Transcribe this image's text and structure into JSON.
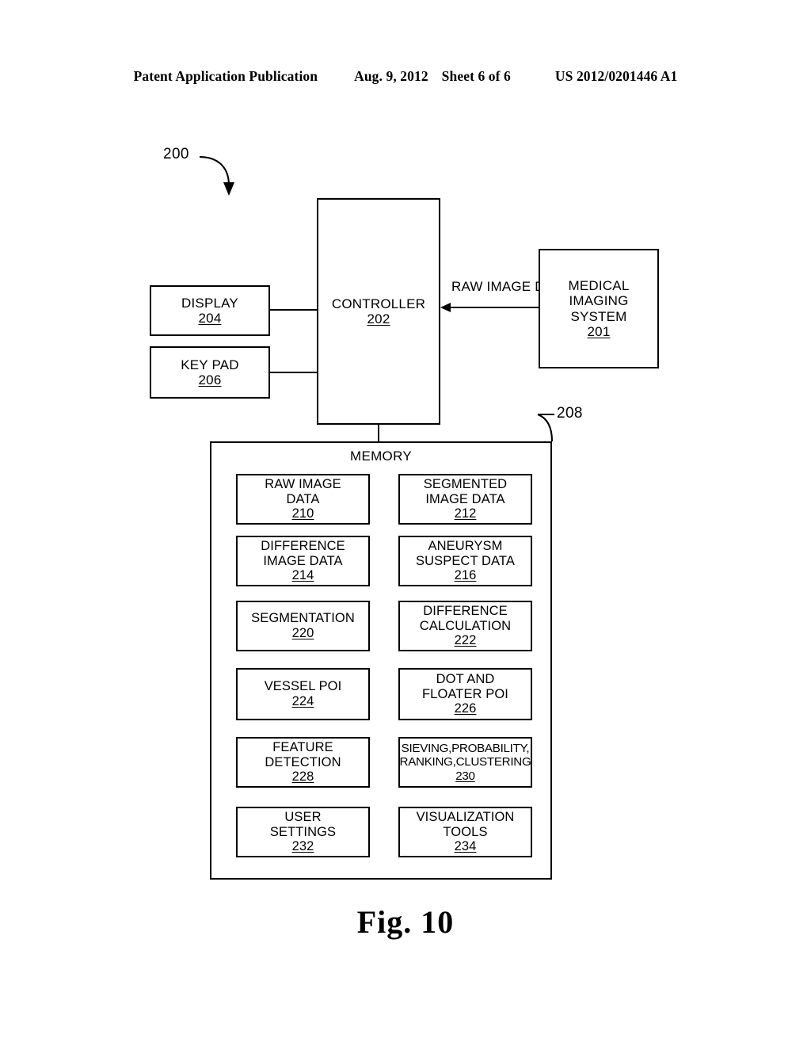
{
  "header": {
    "publication": "Patent Application Publication",
    "date": "Aug. 9, 2012",
    "sheet": "Sheet 6 of 6",
    "number": "US 2012/0201446 A1"
  },
  "figure": {
    "caption": "Fig. 10",
    "system_ref": "200",
    "memory_ref": "208"
  },
  "flow_labels": {
    "raw_image_data_line1": "RAW IMAGE",
    "raw_image_data_line2": "DATA"
  },
  "boxes": {
    "display": {
      "line1": "DISPLAY",
      "ref": "204"
    },
    "keypad": {
      "line1": "KEY PAD",
      "ref": "206"
    },
    "controller": {
      "line1": "CONTROLLER",
      "ref": "202"
    },
    "medical": {
      "line1": "MEDICAL",
      "line2": "IMAGING",
      "line3": "SYSTEM",
      "ref": "201"
    }
  },
  "memory": {
    "title": "MEMORY",
    "cells": [
      {
        "line1": "RAW IMAGE",
        "line2": "DATA",
        "ref": "210"
      },
      {
        "line1": "SEGMENTED",
        "line2": "IMAGE DATA",
        "ref": "212"
      },
      {
        "line1": "DIFFERENCE",
        "line2": "IMAGE DATA",
        "ref": "214"
      },
      {
        "line1": "ANEURYSM",
        "line2": "SUSPECT DATA",
        "ref": "216"
      },
      {
        "line1": "SEGMENTATION",
        "line2": "",
        "ref": "220"
      },
      {
        "line1": "DIFFERENCE",
        "line2": "CALCULATION",
        "ref": "222"
      },
      {
        "line1": "VESSEL POI",
        "line2": "",
        "ref": "224"
      },
      {
        "line1": "DOT AND",
        "line2": "FLOATER POI",
        "ref": "226"
      },
      {
        "line1": "FEATURE",
        "line2": "DETECTION",
        "ref": "228"
      },
      {
        "line1": "SIEVING,PROBABILITY,",
        "line2": "RANKING,CLUSTERING",
        "ref": "230"
      },
      {
        "line1": "USER",
        "line2": "SETTINGS",
        "ref": "232"
      },
      {
        "line1": "VISUALIZATION",
        "line2": "TOOLS",
        "ref": "234"
      }
    ]
  }
}
